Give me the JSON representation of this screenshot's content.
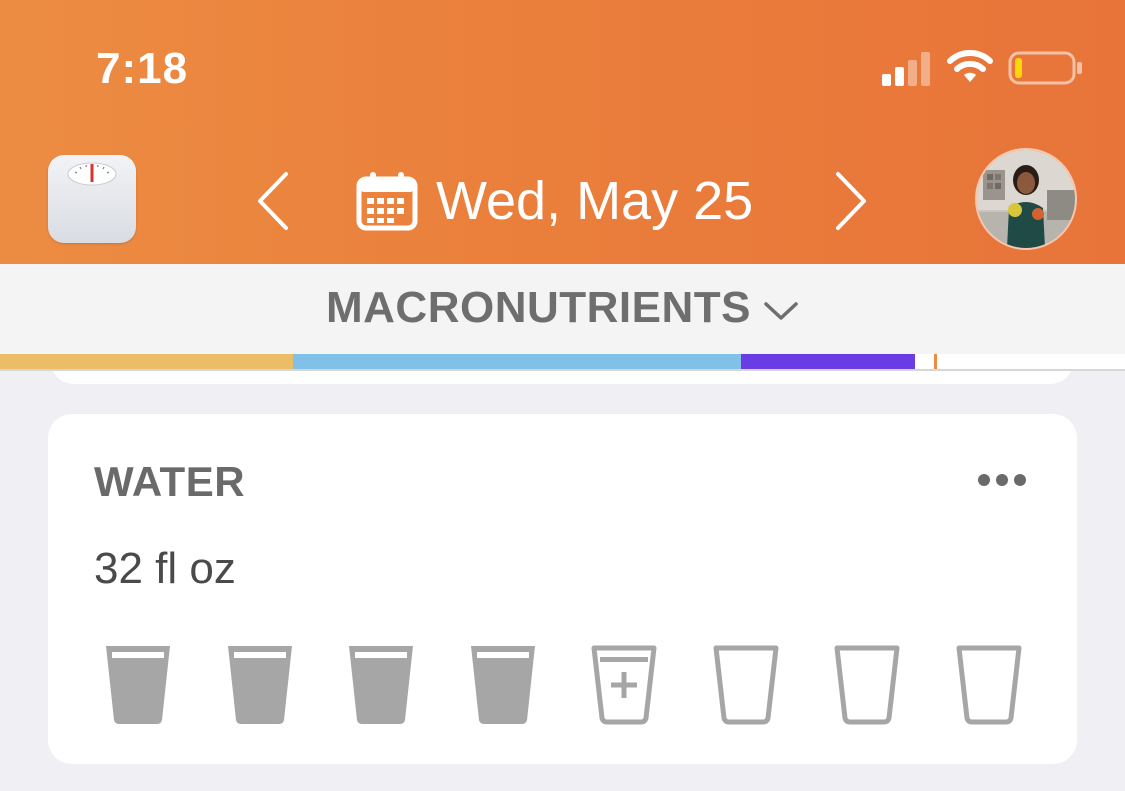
{
  "status_bar": {
    "time": "7:18"
  },
  "header": {
    "date": "Wed, May 25",
    "icons": {
      "scale": "scale-icon",
      "prev": "chevron-left-icon",
      "next": "chevron-right-icon",
      "calendar": "calendar-icon",
      "avatar": "profile-avatar"
    },
    "background_color": "#ea7e3b"
  },
  "macros": {
    "label": "MACRONUTRIENTS",
    "dropdown_icon": "chevron-down-icon",
    "segments": [
      {
        "color": "#ebbd67",
        "fraction": 0.26
      },
      {
        "color": "#80c1e8",
        "fraction": 0.398
      },
      {
        "color": "#6a3ce6",
        "fraction": 0.155
      }
    ],
    "target_color": "#ec8c42"
  },
  "water": {
    "title": "WATER",
    "amount": "32 fl oz",
    "more_icon": "more-horizontal-icon",
    "glasses": [
      {
        "state": "filled"
      },
      {
        "state": "filled"
      },
      {
        "state": "filled"
      },
      {
        "state": "filled"
      },
      {
        "state": "add"
      },
      {
        "state": "empty"
      },
      {
        "state": "empty"
      },
      {
        "state": "empty"
      }
    ],
    "glass_color": "#a6a6a6"
  }
}
